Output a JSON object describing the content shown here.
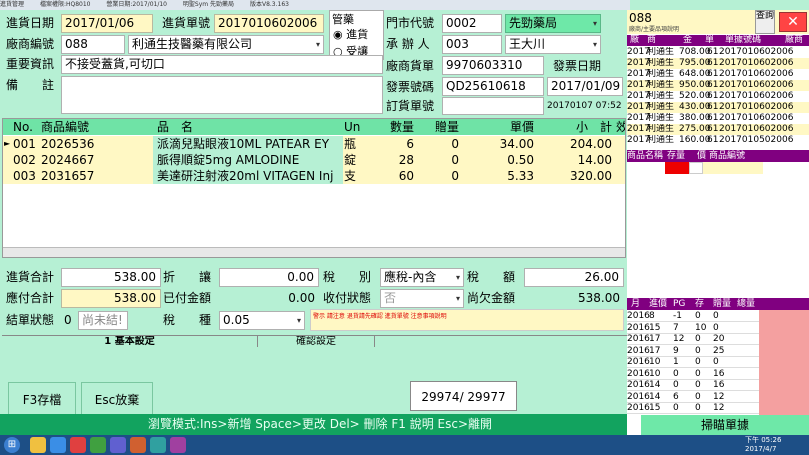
{
  "titlebar": {
    "app": "進貨管理",
    "db": "檔案權限:HQ8010",
    "date": "營業日期:2017/01/10",
    "company": "明聖Sym 先勁藥局",
    "version": "版本V8.3.163"
  },
  "form": {
    "in_date_label": "進貨日期",
    "in_date": "2017/01/06",
    "in_no_label": "進貨單號",
    "in_no": "2017010602006",
    "mgmt_label": "管藥",
    "radio_in": "進貨",
    "radio_return": "受讓",
    "store_label": "門市代號",
    "store_code": "0002",
    "store_name": "先勁藥局",
    "vendor_label": "廠商編號",
    "vendor_code": "088",
    "vendor_name": "利通生技醫藥有限公司",
    "handler_label": "承 辦 人",
    "handler_code": "003",
    "handler_name": "王大川",
    "important_label": "重要資訊",
    "important": "不接受蓋貨,可切口",
    "vendor_bill_label": "廠商貨單",
    "vendor_bill": "9970603310",
    "invoice_date_label": "發票日期",
    "remark_label": "備　　註",
    "invoice_no_label": "發票號碼",
    "invoice_no": "QD25610618",
    "invoice_date": "2017/01/09",
    "order_no_label": "訂貨單號",
    "order_time": "20170107 07:52"
  },
  "grid": {
    "headers": [
      "No.",
      "商品編號",
      "品　名",
      "Un",
      "數量",
      "贈量",
      "單價",
      "小　計",
      "效"
    ],
    "rows": [
      {
        "no": "001",
        "code": "2026536",
        "name": "派滴兒點眼液10ML PATEAR EY",
        "un": "瓶",
        "qty": "6",
        "bonus": "0",
        "price": "34.00",
        "subtotal": "204.00"
      },
      {
        "no": "002",
        "code": "2024667",
        "name": "脈得順錠5mg AMLODINE",
        "un": "錠",
        "qty": "28",
        "bonus": "0",
        "price": "0.50",
        "subtotal": "14.00"
      },
      {
        "no": "003",
        "code": "2031657",
        "name": "美達研注射液20ml VITAGEN Inj",
        "un": "支",
        "qty": "60",
        "bonus": "0",
        "price": "5.33",
        "subtotal": "320.00"
      }
    ]
  },
  "totals": {
    "in_total_label": "進貨合計",
    "in_total": "538.00",
    "discount_label": "折　　讓",
    "discount": "0.00",
    "tax_type_label": "稅　　別",
    "tax_type": "應稅-內含",
    "tax_amount_label": "稅　　額",
    "tax_amount": "26.00",
    "payable_label": "應付合計",
    "payable": "538.00",
    "paid_label": "已付金額",
    "paid": "0.00",
    "received_label": "收付狀態",
    "received": "否",
    "owed_label": "尚欠金額",
    "owed": "538.00",
    "settle_label": "結單狀態",
    "settle_code": "0",
    "settle_text": "尚未結!",
    "tax_kind_label": "稅　　種",
    "tax_kind": "0.05",
    "notice": "警示 請注意 退貨請先確認 進貨單號 注意事項說明"
  },
  "tabs": {
    "basic": "1 基本設定",
    "receipt": "確認設定"
  },
  "buttons": {
    "save": "F3存檔",
    "cancel": "Esc放棄"
  },
  "counter": "29974/ 29977",
  "statusbar": "瀏覽模式:Ins>新增 Space>更改 Del> 刪除  F1 說明 Esc>離開",
  "right": {
    "code": "088",
    "query_btn": "查詢",
    "hint": "廠商/主要品項說明",
    "headers": [
      "廠",
      "商",
      "金",
      "單",
      "單據號碼",
      "廠商"
    ],
    "rows": [
      {
        "a": "2017",
        "b": "利通生",
        "c": "708.00",
        "d": "61",
        "e": "2017010602006"
      },
      {
        "a": "2017",
        "b": "利通生",
        "c": "795.00",
        "d": "61",
        "e": "2017010602006"
      },
      {
        "a": "2017",
        "b": "利通生",
        "c": "648.00",
        "d": "61",
        "e": "2017010602006"
      },
      {
        "a": "2017",
        "b": "利通生",
        "c": "950.00",
        "d": "61",
        "e": "2017010602006"
      },
      {
        "a": "2017",
        "b": "利通生",
        "c": "520.00",
        "d": "61",
        "e": "2017010602006"
      },
      {
        "a": "2017",
        "b": "利通生",
        "c": "430.00",
        "d": "61",
        "e": "2017010602006"
      },
      {
        "a": "2017",
        "b": "利通生",
        "c": "380.00",
        "d": "61",
        "e": "2017010602006"
      },
      {
        "a": "2017",
        "b": "利通生",
        "c": "275.00",
        "d": "61",
        "e": "2017010602006"
      },
      {
        "a": "2017",
        "b": "利通生",
        "c": "160.00",
        "d": "61",
        "e": "2017010502006"
      }
    ],
    "mid_headers": [
      "商品名稱",
      "存量",
      "價",
      "商品編號"
    ],
    "low_headers": [
      "月",
      "進價",
      "PG",
      "存",
      "贈量",
      "總量"
    ],
    "low_rows": [
      [
        "2016",
        "8",
        "-1",
        "0",
        "0"
      ],
      [
        "2016",
        "15",
        "7",
        "10",
        "0"
      ],
      [
        "2016",
        "17",
        "12",
        "0",
        "20"
      ],
      [
        "2016",
        "17",
        "9",
        "0",
        "25"
      ],
      [
        "2016",
        "10",
        "1",
        "0",
        "0"
      ],
      [
        "2016",
        "10",
        "0",
        "0",
        "16"
      ],
      [
        "2016",
        "14",
        "0",
        "0",
        "16"
      ],
      [
        "2016",
        "14",
        "6",
        "0",
        "12"
      ],
      [
        "2016",
        "15",
        "0",
        "0",
        "12"
      ]
    ],
    "scan_btn": "掃瞄單據",
    "clock_time": "下午 05:26",
    "clock_date": "2017/4/7"
  }
}
